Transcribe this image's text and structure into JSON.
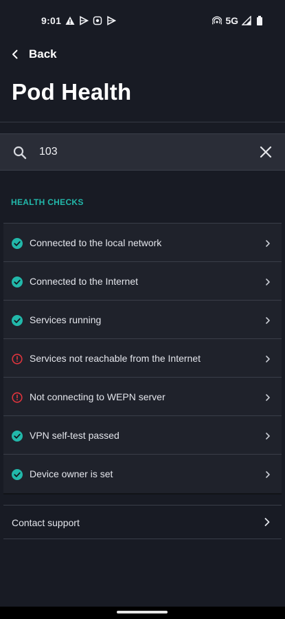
{
  "status_bar": {
    "time": "9:01",
    "network": "5G",
    "left_icons": [
      "warning-icon",
      "play-icon",
      "app-icon",
      "play-icon"
    ],
    "right_icons": [
      "hotspot-icon",
      "signal-icon",
      "battery-icon"
    ]
  },
  "nav": {
    "back_label": "Back"
  },
  "page": {
    "title": "Pod Health"
  },
  "search": {
    "value": "103"
  },
  "section": {
    "header": "HEALTH CHECKS"
  },
  "colors": {
    "ok": "#22b8aa",
    "error": "#e0343d",
    "accent": "#22b8aa"
  },
  "checks": [
    {
      "label": "Connected to the local network",
      "status": "ok"
    },
    {
      "label": "Connected to the Internet",
      "status": "ok"
    },
    {
      "label": "Services running",
      "status": "ok"
    },
    {
      "label": "Services not reachable from the Internet",
      "status": "error"
    },
    {
      "label": "Not connecting to WEPN server",
      "status": "error"
    },
    {
      "label": "VPN self-test passed",
      "status": "ok"
    },
    {
      "label": "Device owner is set",
      "status": "ok"
    }
  ],
  "support": {
    "label": "Contact support"
  }
}
